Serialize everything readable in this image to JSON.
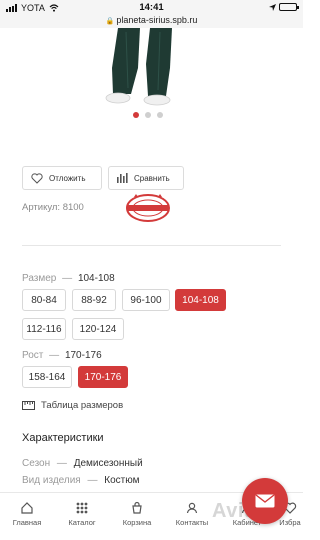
{
  "status_bar": {
    "carrier": "YOTA",
    "time": "14:41",
    "url": "planeta-sirius.spb.ru"
  },
  "gallery": {
    "image_count": 3,
    "active_index": 0
  },
  "actions": {
    "defer_label": "Отложить",
    "compare_label": "Сравнить"
  },
  "article": {
    "text": "Артикул: 8100"
  },
  "size": {
    "label": "Размер",
    "dash": "—",
    "selected": "104-108",
    "options": [
      "80-84",
      "88-92",
      "96-100",
      "104-108",
      "112-116",
      "120-124"
    ]
  },
  "height": {
    "label": "Рост",
    "dash": "—",
    "selected": "170-176",
    "options": [
      "158-164",
      "170-176"
    ]
  },
  "size_table": {
    "label": "Таблица размеров"
  },
  "characteristics": {
    "title": "Характеристики",
    "rows": [
      {
        "name": "Сезон",
        "dash": "—",
        "value": "Демисезонный"
      },
      {
        "name": "Вид изделия",
        "dash": "—",
        "value": "Костюм"
      }
    ]
  },
  "bottom_nav": {
    "items": [
      {
        "label": "Главная",
        "icon": "home-icon"
      },
      {
        "label": "Каталог",
        "icon": "catalog-grid-icon"
      },
      {
        "label": "Корзина",
        "icon": "cart-icon"
      },
      {
        "label": "Контакты",
        "icon": "contacts-icon"
      },
      {
        "label": "Кабинет",
        "icon": "user-icon"
      },
      {
        "label": "Избра",
        "icon": "heart-icon"
      }
    ]
  },
  "watermark": {
    "text": "Avito"
  },
  "colors": {
    "accent": "#d33a3a",
    "chip_border": "#d8d8d8",
    "muted_text": "#9a9a9a"
  }
}
